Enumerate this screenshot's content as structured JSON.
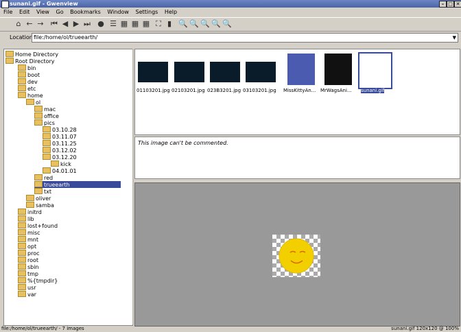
{
  "window": {
    "title": "sunani.gif - Gwenview"
  },
  "menu": [
    "File",
    "Edit",
    "View",
    "Go",
    "Bookmarks",
    "Window",
    "Settings",
    "Help"
  ],
  "location": {
    "label": "Location:",
    "value": "file:/home/ol/trueearth/"
  },
  "tree": [
    "Home Directory",
    "Root Directory",
    "bin",
    "boot",
    "dev",
    "etc",
    "home",
    "ol",
    "mac",
    "office",
    "pics",
    "03.10.28",
    "03.11.07",
    "03.11.25",
    "03.12.02",
    "03.12.20",
    "kick",
    "04.01.01",
    "red",
    "trueearth",
    "txt",
    "oliver",
    "samba",
    "initrd",
    "lib",
    "lost+found",
    "misc",
    "mnt",
    "opt",
    "proc",
    "root",
    "sbin",
    "tmp",
    "%{tmpdir}",
    "usr",
    "var"
  ],
  "thumbnails": [
    "01103201.jpg",
    "02103201.jpg",
    "023B3201.jpg",
    "03103201.jpg",
    "MissKittyAn...",
    "MrWagsAni...",
    "sunani.gif"
  ],
  "comment": "This image can't be commented.",
  "status": {
    "left": "file:/home/ol/trueearth/ - 7 images",
    "right": "sunani.gif 120x120 @ 100%"
  }
}
